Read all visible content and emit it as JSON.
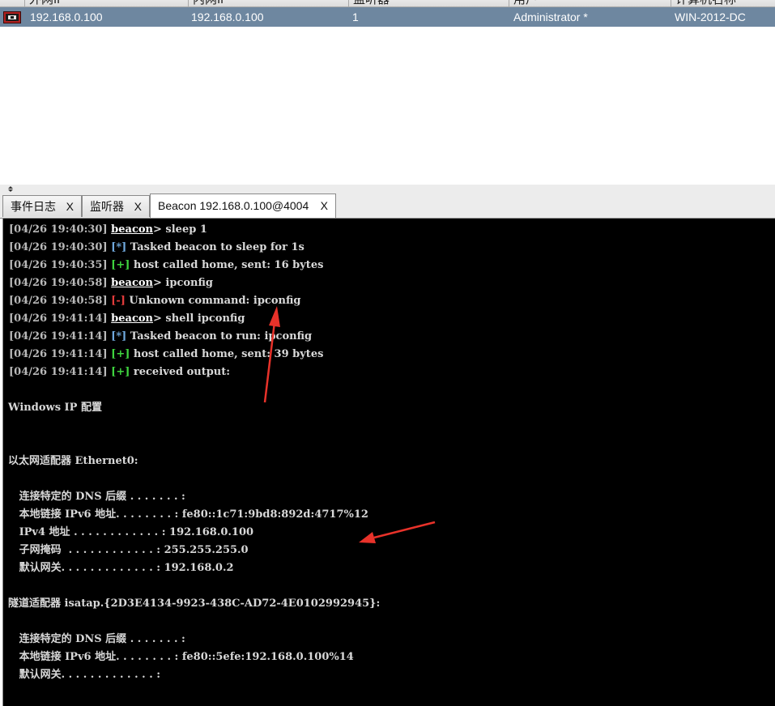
{
  "sessions": {
    "columns": [
      "外网IP",
      "内网IP",
      "监听器",
      "用户",
      "计算机名称"
    ],
    "rows": [
      {
        "external": "192.168.0.100",
        "internal": "192.168.0.100",
        "listener": "1",
        "user": "Administrator *",
        "computer": "WIN-2012-DC"
      }
    ]
  },
  "tabs": [
    {
      "label": "事件日志",
      "close": "X"
    },
    {
      "label": "监听器",
      "close": "X"
    },
    {
      "label": "Beacon 192.168.0.100@4004",
      "close": "X"
    }
  ],
  "console": {
    "log": [
      {
        "ts": "[04/26 19:40:30]",
        "kind": "prompt",
        "marker": "beacon",
        "text": "> sleep 1"
      },
      {
        "ts": "[04/26 19:40:30]",
        "kind": "info",
        "marker": "[*]",
        "text": " Tasked beacon to sleep for 1s"
      },
      {
        "ts": "[04/26 19:40:35]",
        "kind": "ok",
        "marker": "[+]",
        "text": " host called home, sent: 16 bytes"
      },
      {
        "ts": "[04/26 19:40:58]",
        "kind": "prompt",
        "marker": "beacon",
        "text": "> ipconfig"
      },
      {
        "ts": "[04/26 19:40:58]",
        "kind": "err",
        "marker": "[-]",
        "text": " Unknown command: ipconfig"
      },
      {
        "ts": "[04/26 19:41:14]",
        "kind": "prompt",
        "marker": "beacon",
        "text": "> shell ipconfig"
      },
      {
        "ts": "[04/26 19:41:14]",
        "kind": "info",
        "marker": "[*]",
        "text": " Tasked beacon to run: ipconfig"
      },
      {
        "ts": "[04/26 19:41:14]",
        "kind": "ok",
        "marker": "[+]",
        "text": " host called home, sent: 39 bytes"
      },
      {
        "ts": "[04/26 19:41:14]",
        "kind": "ok",
        "marker": "[+]",
        "text": " received output:"
      }
    ],
    "output": [
      {
        "row": 10,
        "text": "Windows IP 配置"
      },
      {
        "row": 13,
        "text": "以太网适配器 Ethernet0:"
      },
      {
        "row": 15,
        "text": "   连接特定的 DNS 后缀 . . . . . . . :"
      },
      {
        "row": 16,
        "text": "   本地链接 IPv6 地址. . . . . . . . : fe80::1c71:9bd8:892d:4717%12"
      },
      {
        "row": 17,
        "text": "   IPv4 地址 . . . . . . . . . . . . : 192.168.0.100"
      },
      {
        "row": 18,
        "text": "   子网掩码  . . . . . . . . . . . . : 255.255.255.0"
      },
      {
        "row": 19,
        "text": "   默认网关. . . . . . . . . . . . . : 192.168.0.2"
      },
      {
        "row": 21,
        "text": "隧道适配器 isatap.{2D3E4134-9923-438C-AD72-4E0102992945}:"
      },
      {
        "row": 23,
        "text": "   连接特定的 DNS 后缀 . . . . . . . :"
      },
      {
        "row": 24,
        "text": "   本地链接 IPv6 地址. . . . . . . . : fe80::5efe:192.168.0.100%14"
      },
      {
        "row": 25,
        "text": "   默认网关. . . . . . . . . . . . . :"
      }
    ]
  },
  "annotations": {
    "arrow_color": "#e8322a"
  }
}
